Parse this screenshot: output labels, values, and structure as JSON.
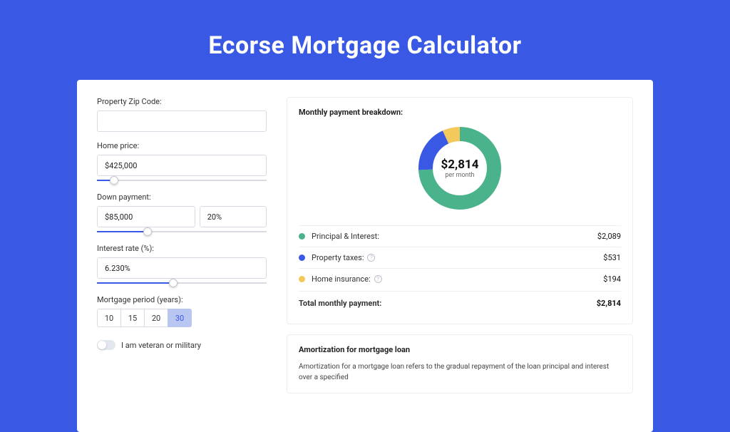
{
  "title": "Ecorse Mortgage Calculator",
  "form": {
    "zip": {
      "label": "Property Zip Code:",
      "value": ""
    },
    "price": {
      "label": "Home price:",
      "value": "$425,000",
      "slider_pct": 10
    },
    "down": {
      "label": "Down payment:",
      "amount": "$85,000",
      "pct": "20%",
      "slider_pct": 30
    },
    "rate": {
      "label": "Interest rate (%):",
      "value": "6.230%",
      "slider_pct": 45
    },
    "period": {
      "label": "Mortgage period (years):",
      "options": [
        "10",
        "15",
        "20",
        "30"
      ],
      "selected": "30"
    },
    "veteran": {
      "label": "I am veteran or military",
      "on": false
    }
  },
  "breakdown": {
    "title": "Monthly payment breakdown:",
    "total": "$2,814",
    "total_sub": "per month",
    "rows": [
      {
        "label": "Principal & Interest:",
        "value": "$2,089",
        "color": "#4bb38c",
        "info": false
      },
      {
        "label": "Property taxes:",
        "value": "$531",
        "color": "#3959e5",
        "info": true
      },
      {
        "label": "Home insurance:",
        "value": "$194",
        "color": "#f3c95b",
        "info": true
      }
    ],
    "total_row": {
      "label": "Total monthly payment:",
      "value": "$2,814"
    }
  },
  "chart_data": {
    "type": "pie",
    "title": "Monthly payment breakdown",
    "series": [
      {
        "name": "Principal & Interest",
        "value": 2089,
        "color": "#4bb38c"
      },
      {
        "name": "Property taxes",
        "value": 531,
        "color": "#3959e5"
      },
      {
        "name": "Home insurance",
        "value": 194,
        "color": "#f3c95b"
      }
    ],
    "total": 2814,
    "center_label": "$2,814",
    "center_sub": "per month"
  },
  "amort": {
    "title": "Amortization for mortgage loan",
    "text": "Amortization for a mortgage loan refers to the gradual repayment of the loan principal and interest over a specified"
  }
}
